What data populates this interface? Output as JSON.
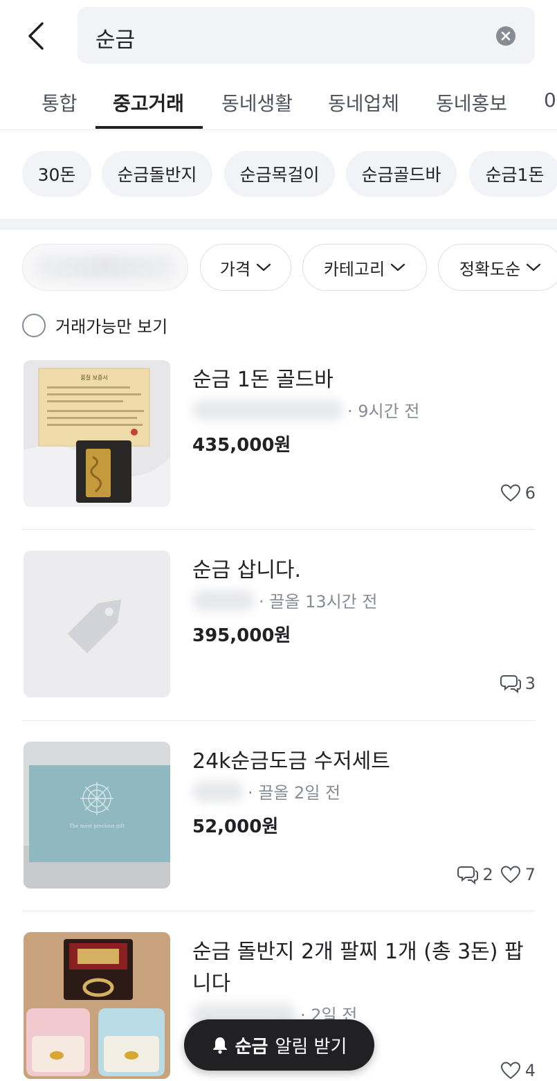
{
  "search": {
    "query": "순금"
  },
  "tabs": [
    {
      "label": "통합"
    },
    {
      "label": "중고거래"
    },
    {
      "label": "동네생활"
    },
    {
      "label": "동네업체"
    },
    {
      "label": "동네홍보"
    },
    {
      "label": "0"
    }
  ],
  "suggestions": [
    "30돈",
    "순금돌반지",
    "순금목걸이",
    "순금골드바",
    "순금1돈"
  ],
  "filters": [
    {
      "label": "가격"
    },
    {
      "label": "카테고리"
    },
    {
      "label": "정확도순"
    }
  ],
  "availability_label": "거래가능만 보기",
  "listings": [
    {
      "title": "순금 1돈 골드바",
      "meta_prefix": "동",
      "meta_suffix": "동",
      "time": "· 9시간 전",
      "price": "435,000원",
      "chats": "",
      "likes": "6"
    },
    {
      "title": "순금 삽니다.",
      "meta_prefix": "",
      "meta_suffix": "",
      "time": "· 끌올 13시간 전",
      "price": "395,000원",
      "chats": "3",
      "likes": ""
    },
    {
      "title": "24k순금도금 수저세트",
      "meta_prefix": "",
      "meta_suffix": "",
      "time": "· 끌올 2일 전",
      "price": "52,000원",
      "chats": "2",
      "likes": "7"
    },
    {
      "title": "순금 돌반지 2개 팔찌 1개 (총 3돈) 팝니다",
      "meta_prefix": "",
      "meta_suffix": "",
      "time": "· 2일 전",
      "price": "",
      "chats": "",
      "likes": "4"
    }
  ],
  "alert_button": {
    "keyword": "순금",
    "label": "알림 받기"
  },
  "colors": {
    "text": "#212124",
    "muted": "#868b94",
    "chip_bg": "#f2f3f6",
    "dark_button": "#212124"
  },
  "thumbnail_text": {
    "certificate": "품질 보증서",
    "card": "The most precious gift"
  }
}
